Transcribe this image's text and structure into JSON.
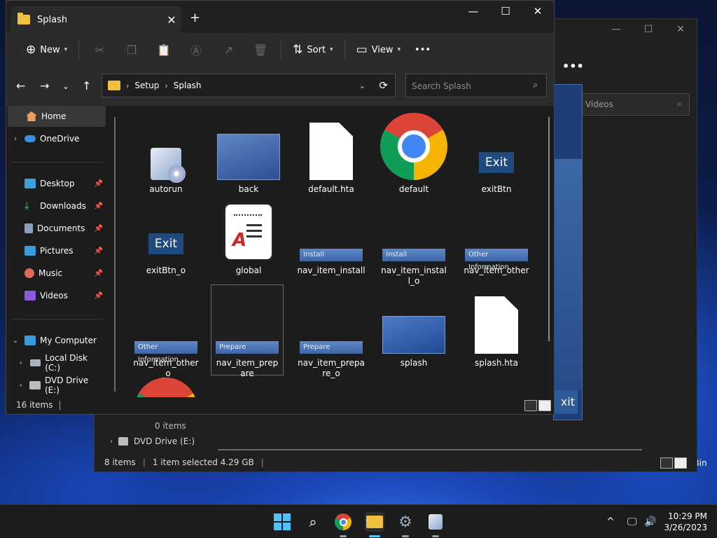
{
  "desktop": {
    "recycle_bin_label": "Recycle Bin"
  },
  "back_window": {
    "window_controls": [
      "—",
      "☐",
      "✕"
    ],
    "more_label": "•••",
    "search_placeholder": "Search Videos",
    "search_partial": "Videos",
    "zero_items": "0 items",
    "dvd_drive": "DVD Drive (E:)",
    "status_items": "8 items",
    "status_selected": "1 item selected  4.29 GB",
    "dialog_exit_text": "xit"
  },
  "main_window": {
    "tab_title": "Splash",
    "tab_close": "✕",
    "new_tab": "+",
    "window_controls": [
      "—",
      "☐",
      "✕"
    ],
    "toolbar": {
      "new_label": "New",
      "sort_label": "Sort",
      "view_label": "View",
      "more_label": "•••"
    },
    "address": {
      "crumbs": [
        "Setup",
        "Splash"
      ],
      "search_placeholder": "Search Splash"
    },
    "sidebar": {
      "home": "Home",
      "onedrive": "OneDrive",
      "quick": [
        "Desktop",
        "Downloads",
        "Documents",
        "Pictures",
        "Music",
        "Videos"
      ],
      "my_computer": "My Computer",
      "local_disk": "Local Disk (C:)",
      "dvd_drive": "DVD Drive (E:)"
    },
    "files": [
      {
        "name": "autorun",
        "kind": "autorun"
      },
      {
        "name": "back",
        "kind": "image"
      },
      {
        "name": "default.hta",
        "kind": "doc"
      },
      {
        "name": "default",
        "kind": "chrome"
      },
      {
        "name": "exitBtn",
        "kind": "exit",
        "thumb": "Exit"
      },
      {
        "name": "exitBtn_o",
        "kind": "exit",
        "thumb": "Exit"
      },
      {
        "name": "global",
        "kind": "global"
      },
      {
        "name": "nav_item_install",
        "kind": "nav",
        "thumb": "Install"
      },
      {
        "name": "nav_item_install_o",
        "kind": "nav",
        "thumb": "Install"
      },
      {
        "name": "nav_item_other",
        "kind": "nav",
        "thumb": "Other Information"
      },
      {
        "name": "nav_item_other_o",
        "kind": "nav",
        "thumb": "Other Information"
      },
      {
        "name": "nav_item_prepare",
        "kind": "nav",
        "thumb": "Prepare"
      },
      {
        "name": "nav_item_prepare_o",
        "kind": "nav",
        "thumb": "Prepare"
      },
      {
        "name": "splash",
        "kind": "splash"
      },
      {
        "name": "splash.hta",
        "kind": "doc"
      }
    ],
    "status_count": "16 items"
  },
  "taskbar": {
    "time": "10:29 PM",
    "date": "3/26/2023"
  },
  "colors": {
    "accent": "#4cc2ff",
    "folder": "#f0c040",
    "window_bg": "#1c1c1c",
    "toolbar_bg": "#2b2b2b"
  }
}
